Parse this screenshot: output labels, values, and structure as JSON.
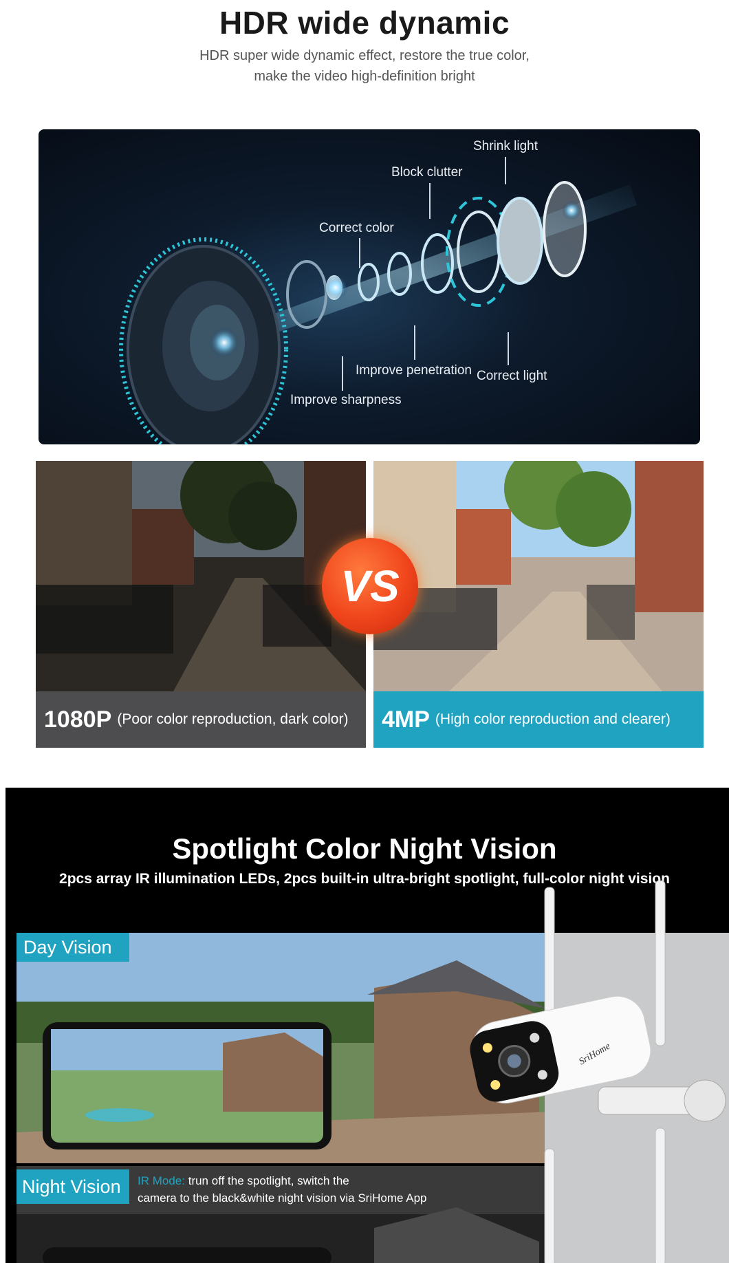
{
  "hdr": {
    "title": "HDR wide dynamic",
    "subtitle_line1": "HDR super wide dynamic effect, restore the true color,",
    "subtitle_line2": "make the video high-definition bright"
  },
  "lens_labels": {
    "shrink_light": "Shrink light",
    "block_clutter": "Block clutter",
    "correct_color": "Correct color",
    "improve_penetration": "Improve penetration",
    "correct_light": "Correct light",
    "improve_sharpness": "Improve sharpness"
  },
  "compare": {
    "left_big": "1080P",
    "left_small": "(Poor color reproduction, dark color)",
    "right_big": "4MP",
    "right_small": "(High color reproduction and clearer)",
    "vs": "VS"
  },
  "night": {
    "title": "Spotlight Color Night Vision",
    "subtitle": "2pcs array IR illumination LEDs, 2pcs built-in ultra-bright spotlight, full-color night vision",
    "day_tag": "Day Vision",
    "night_tag": "Night Vision",
    "ir_label": "IR Mode:",
    "ir_text_1": "trun off the spotlight, switch the",
    "ir_text_2": "camera to the black&white night vision via SriHome App",
    "brand": "SriHome"
  },
  "colors": {
    "accent": "#1fa3c1",
    "vs": "#f0451c",
    "caption_left": "#4d4d4f"
  }
}
